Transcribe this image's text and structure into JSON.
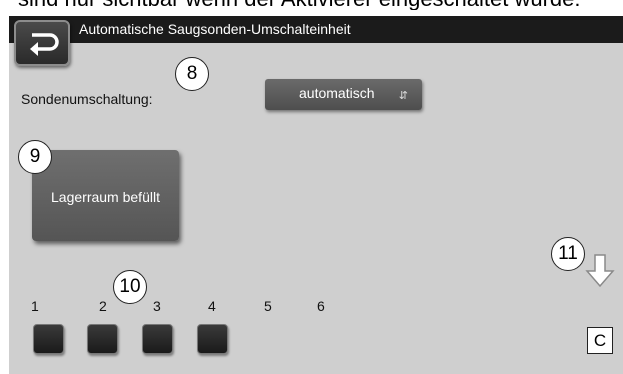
{
  "top_fragment": "sind nur sichtbar wenn der Aktivierer eingeschaltet wurde:",
  "header": {
    "title": "Automatische Saugsonden-Umschalteinheit"
  },
  "back_button": {
    "icon": "back-arrow-icon"
  },
  "settings": {
    "switching_label": "Sondenumschaltung:",
    "switching_value": "automatisch",
    "dropdown_icon": "chevron-updown-icon"
  },
  "store_button": {
    "label": "Lagerraum befüllt"
  },
  "callouts": {
    "c8": "8",
    "c9": "9",
    "c10": "10",
    "c11": "11"
  },
  "probes": {
    "labels": [
      "1",
      "2",
      "3",
      "4",
      "5",
      "6"
    ],
    "buttons_visible": 4
  },
  "nav": {
    "down_icon": "arrow-down-icon",
    "c_label": "C"
  },
  "colors": {
    "screen_bg": "#cfcfcf",
    "titlebar": "#1b1b1b",
    "button": "#5f5f5f"
  }
}
